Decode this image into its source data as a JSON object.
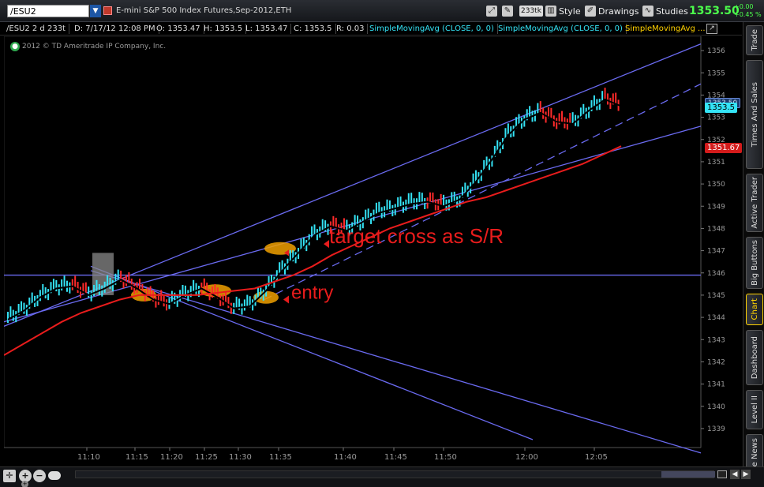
{
  "toolbar": {
    "symbol": "/ESU2",
    "description": "E-mini S&P 500 Index Futures,Sep-2012,ETH",
    "aggregation": "233tk",
    "style_label": "Style",
    "drawings_label": "Drawings",
    "studies_label": "Studies",
    "last_price": "1353.50",
    "change": "+0.00",
    "change_pct": "+0.45 %"
  },
  "infobar": {
    "symbol_period": "/ESU2 2 d 233t",
    "date": "D: 7/17/12 12:08 PM",
    "open": "O: 1353.47",
    "high": "H: 1353.5",
    "low": "L: 1353.47",
    "close": "C: 1353.5",
    "range": "R: 0.03",
    "study1": "SimpleMovingAvg (CLOSE, 0, 0)",
    "study2": "SimpleMovingAvg (CLOSE, 0, 0)",
    "study3": "SimpleMovingAvg ..."
  },
  "copyright": "2012 © TD Ameritrade IP Company, Inc.",
  "annotations": {
    "target": "target cross as S/R",
    "entry": "entry"
  },
  "price_tags": {
    "last": "1353.5",
    "last_alt": "1353.50",
    "sma": "1351.67"
  },
  "chart_data": {
    "type": "line",
    "y_ticks": [
      1339,
      1340,
      1341,
      1342,
      1343,
      1344,
      1345,
      1346,
      1347,
      1348,
      1349,
      1350,
      1351,
      1352,
      1353,
      1354,
      1355,
      1356
    ],
    "x_ticks": [
      "11:10",
      "11:15",
      "11:20",
      "11:25",
      "11:30",
      "11:35",
      "11:40",
      "11:45",
      "11:50",
      "12:00",
      "12:05"
    ],
    "ylim": [
      1338.5,
      1356.5
    ],
    "series": [
      {
        "values": [
          1344.0,
          1344.4,
          1345.0,
          1345.4,
          1345.5,
          1345.1,
          1345.4,
          1345.8,
          1345.4,
          1344.9,
          1344.7,
          1345.1,
          1345.4,
          1345.0,
          1344.5,
          1344.6,
          1345.3,
          1346.2,
          1347.0,
          1347.8,
          1348.2,
          1348.0,
          1348.4,
          1348.8,
          1349.0,
          1349.2,
          1349.3,
          1349.1,
          1349.4,
          1350.2,
          1351.2,
          1352.3,
          1353.0,
          1353.3,
          1352.9,
          1352.8,
          1353.4,
          1353.9,
          1353.6
        ]
      },
      {
        "values": [
          1342.3,
          1342.8,
          1343.3,
          1343.8,
          1344.2,
          1344.5,
          1344.8,
          1345.0,
          1345.0,
          1345.0,
          1345.0,
          1345.1,
          1345.2,
          1345.3,
          1345.6,
          1345.9,
          1346.3,
          1346.8,
          1347.2,
          1347.6,
          1348.0,
          1348.3,
          1348.6,
          1348.9,
          1349.2,
          1349.4,
          1349.7,
          1350.0,
          1350.3,
          1350.6,
          1350.9,
          1351.3,
          1351.7
        ]
      }
    ],
    "grid": false
  },
  "sidebar": {
    "tabs": [
      "Trade",
      "Times And Sales",
      "Active Trader",
      "Big Buttons",
      "Chart",
      "Dashboard",
      "Level II",
      "Live News"
    ],
    "active": "Chart"
  }
}
